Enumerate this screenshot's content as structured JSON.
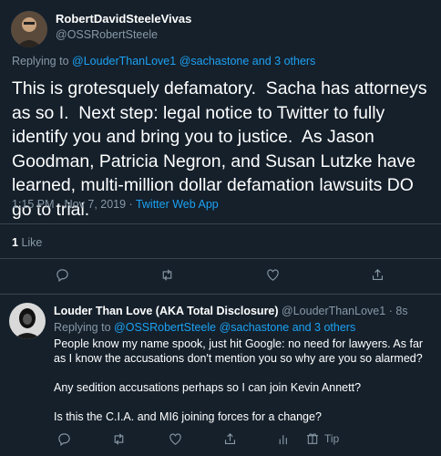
{
  "main": {
    "author_name": "RobertDavidSteeleVivas",
    "author_handle": "@OSSRobertSteele",
    "replying_prefix": "Replying to",
    "replying_to_1": "@LouderThanLove1",
    "replying_to_2": "@sachastone",
    "replying_and": "and",
    "replying_others": "3 others",
    "text": "This is grotesquely defamatory.  Sacha has attorneys as so I.  Next step: legal notice to Twitter to fully identify you and bring you to justice.  As Jason Goodman, Patricia Negron, and Susan Lutzke have learned, multi-million dollar defamation lawsuits DO go to trial.",
    "timestamp": "1:15 PM · Nov 7, 2019 ·",
    "source": "Twitter Web App",
    "likes_count": "1",
    "likes_label": "Like"
  },
  "reply": {
    "author_name": "Louder Than Love (AKA Total Disclosure)",
    "author_handle": "@LouderThanLove1",
    "time": "· 8s",
    "replying_prefix": "Replying to",
    "replying_to_1": "@OSSRobertSteele",
    "replying_to_2": "@sachastone",
    "replying_and": "and",
    "replying_others": "3 others",
    "para1": "People know my name spook, just hit Google: no need for lawyers. As far as I know the accusations don't mention you so why are you so alarmed?",
    "para2": "Any sedition accusations perhaps so I can join Kevin Annett?",
    "para3": "Is this the C.I.A. and MI6 joining forces for a change?",
    "tip_label": "Tip"
  },
  "colors": {
    "background": "#15202b",
    "accent": "#1da1f2",
    "muted": "#8899a6",
    "divider": "#38444d"
  },
  "icons": [
    "reply-icon",
    "retweet-icon",
    "like-icon",
    "share-icon",
    "analytics-icon",
    "tip-icon"
  ]
}
